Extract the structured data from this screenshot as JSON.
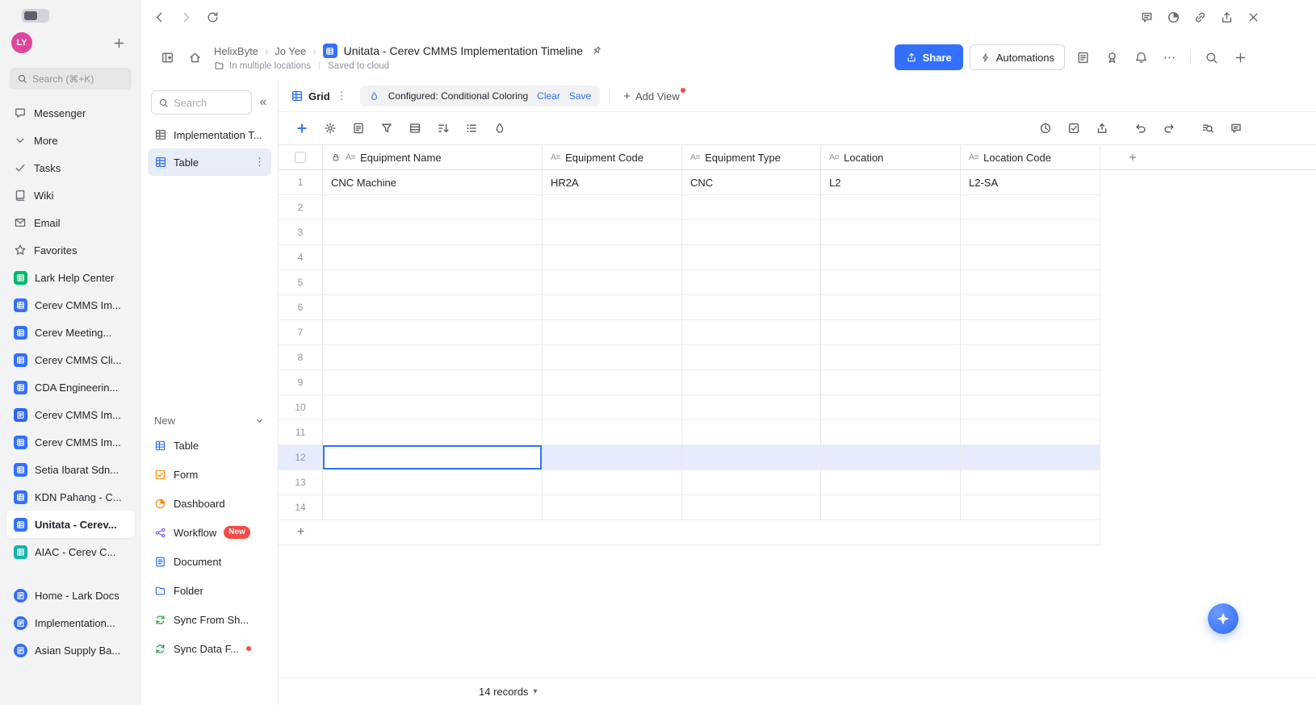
{
  "app": {
    "name": "Lark Base",
    "accent_color": "#3370ff",
    "row_highlight_color": "#e6ecfb",
    "badge_red": "#f54a45"
  },
  "icons": {
    "text_field_glyph": "A≡",
    "more_vertical": "⋮",
    "more_horizontal": "⋯",
    "collapse": "«",
    "caret_down": "▾",
    "breadcrumb_sep": "›",
    "plus": "+"
  },
  "left_sidebar": {
    "avatar_initials": "LY",
    "search_placeholder": "Search (⌘+K)",
    "items": [
      {
        "label": "Messenger",
        "icon": "chat"
      },
      {
        "label": "More",
        "icon": "chevronDown"
      },
      {
        "label": "Tasks",
        "icon": "check"
      },
      {
        "label": "Wiki",
        "icon": "book"
      },
      {
        "label": "Email",
        "icon": "mail"
      },
      {
        "label": "Favorites",
        "icon": "star"
      },
      {
        "label": "Lark Help Center",
        "icon": "square",
        "icon_color": "#00b96b"
      },
      {
        "label": "Cerev CMMS Im...",
        "icon": "square",
        "icon_color": "#3370ff"
      },
      {
        "label": "Cerev Meeting...",
        "icon": "square",
        "icon_color": "#3370ff"
      },
      {
        "label": "Cerev CMMS Cli...",
        "icon": "square",
        "icon_color": "#3370ff"
      },
      {
        "label": "CDA Engineerin...",
        "icon": "square",
        "icon_color": "#3370ff"
      },
      {
        "label": "Cerev CMMS Im...",
        "icon": "doc",
        "icon_color": "#2e65f0"
      },
      {
        "label": "Cerev CMMS Im...",
        "icon": "square",
        "icon_color": "#3370ff"
      },
      {
        "label": "Setia Ibarat Sdn...",
        "icon": "square",
        "icon_color": "#3370ff"
      },
      {
        "label": "KDN Pahang - C...",
        "icon": "square",
        "icon_color": "#3370ff"
      },
      {
        "label": "Unitata - Cerev...",
        "icon": "square",
        "icon_color": "#3370ff",
        "selected": true
      },
      {
        "label": "AIAC - Cerev C...",
        "icon": "square",
        "icon_color": "#12b5ab",
        "gap_after": true
      },
      {
        "label": "Home - Lark Docs",
        "icon": "circle",
        "icon_color": "#336df4"
      },
      {
        "label": "Implementation...",
        "icon": "circle",
        "icon_color": "#336df4"
      },
      {
        "label": "Asian Supply Ba...",
        "icon": "circle",
        "icon_color": "#336df4"
      }
    ]
  },
  "header": {
    "breadcrumb": [
      {
        "label": "HelixByte"
      },
      {
        "label": "Jo Yee"
      },
      {
        "label": "Unitata - Cerev CMMS Implementation Timeline"
      }
    ],
    "location_note": "In multiple locations",
    "saved_note": "Saved to cloud",
    "share_label": "Share",
    "automations_label": "Automations"
  },
  "table_panel": {
    "search_placeholder": "Search",
    "tables": [
      {
        "label": "Implementation T...",
        "selected": false
      },
      {
        "label": "Table",
        "selected": true
      }
    ],
    "new_section_label": "New",
    "new_items": [
      {
        "label": "Table",
        "icon": "grid",
        "icon_color": "#3370ff"
      },
      {
        "label": "Form",
        "icon": "checklist",
        "icon_color": "#ff8800"
      },
      {
        "label": "Dashboard",
        "icon": "pie",
        "icon_color": "#ff8800"
      },
      {
        "label": "Workflow",
        "icon": "flow",
        "icon_color": "#7b61ff",
        "badge": "New"
      },
      {
        "label": "Document",
        "icon": "formDoc",
        "icon_color": "#3370ff"
      },
      {
        "label": "Folder",
        "icon": "folder",
        "icon_color": "#3370ff"
      },
      {
        "label": "Sync From Sh...",
        "icon": "sync",
        "icon_color": "#2ba245"
      },
      {
        "label": "Sync Data F...",
        "icon": "sync",
        "icon_color": "#2ba245",
        "dot": true
      }
    ]
  },
  "view_bar": {
    "view_name": "Grid",
    "config_text": "Configured: Conditional Coloring",
    "clear_label": "Clear",
    "save_label": "Save",
    "add_view_label": "Add View"
  },
  "grid": {
    "columns": [
      {
        "label": "Equipment Name",
        "locked": true
      },
      {
        "label": "Equipment Code"
      },
      {
        "label": "Equipment Type"
      },
      {
        "label": "Location"
      },
      {
        "label": "Location Code"
      }
    ],
    "selected_column": "Equipment Name",
    "rows": [
      {
        "num": "1",
        "cells": [
          "CNC Machine",
          "HR2A",
          "CNC",
          "L2",
          "L2-SA"
        ]
      },
      {
        "num": "2",
        "cells": [
          "",
          "",
          "",
          "",
          ""
        ]
      },
      {
        "num": "3",
        "cells": [
          "",
          "",
          "",
          "",
          ""
        ]
      },
      {
        "num": "4",
        "cells": [
          "",
          "",
          "",
          "",
          ""
        ]
      },
      {
        "num": "5",
        "cells": [
          "",
          "",
          "",
          "",
          ""
        ]
      },
      {
        "num": "6",
        "cells": [
          "",
          "",
          "",
          "",
          ""
        ]
      },
      {
        "num": "7",
        "cells": [
          "",
          "",
          "",
          "",
          ""
        ]
      },
      {
        "num": "8",
        "cells": [
          "",
          "",
          "",
          "",
          ""
        ]
      },
      {
        "num": "9",
        "cells": [
          "",
          "",
          "",
          "",
          ""
        ]
      },
      {
        "num": "10",
        "cells": [
          "",
          "",
          "",
          "",
          ""
        ]
      },
      {
        "num": "11",
        "cells": [
          "",
          "",
          "",
          "",
          ""
        ]
      },
      {
        "num": "12",
        "cells": [
          "",
          "",
          "",
          "",
          ""
        ],
        "selected": true
      },
      {
        "num": "13",
        "cells": [
          "",
          "",
          "",
          "",
          ""
        ]
      },
      {
        "num": "14",
        "cells": [
          "",
          "",
          "",
          "",
          ""
        ]
      }
    ],
    "record_count": "14 records"
  }
}
